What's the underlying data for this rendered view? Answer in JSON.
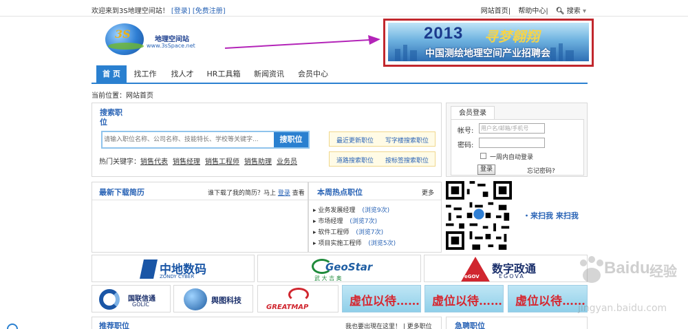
{
  "topbar": {
    "welcome": "欢迎来到3S地理空间站！",
    "login": "[登录]",
    "register": "[免费注册]",
    "home": "网站首页",
    "help": "帮助中心",
    "search": "搜索"
  },
  "logo": {
    "mark": "3S",
    "name": "地理空间站",
    "url": "www.3sSpace.net"
  },
  "banner": {
    "year": "2013",
    "slogan": "寻梦翱翔",
    "subtitle": "中国测绘地理空间产业招聘会"
  },
  "nav": {
    "items": [
      {
        "label": "首 页"
      },
      {
        "label": "找工作"
      },
      {
        "label": "找人才"
      },
      {
        "label": "HR工具箱"
      },
      {
        "label": "新闻资讯"
      },
      {
        "label": "会员中心"
      }
    ]
  },
  "breadcrumb": "当前位置：网站首页",
  "search": {
    "title": "搜索职位",
    "placeholder": "请输入职位名称、公司名称、技能特长、学校等关键字...",
    "button": "搜职位",
    "hot_label": "热门关键字：",
    "hot_keywords": [
      "销售代表",
      "销售经理",
      "销售工程师",
      "销售助理",
      "业务员"
    ],
    "quick_links": [
      "最近更新职位",
      "写字楼搜索职位",
      "道路搜索职位",
      "按标签搜索职位"
    ]
  },
  "login": {
    "tab": "会员登录",
    "account_label": "帐号:",
    "account_placeholder": "用户名/邮箱/手机号",
    "password_label": "密码:",
    "remember": "一周内自动登录",
    "button": "登录",
    "forgot": "忘记密码?"
  },
  "resumes": {
    "title": "最新下载简历",
    "prompt": "谁下载了我的简历？马上",
    "prompt_link": "登录",
    "prompt_tail": "查看"
  },
  "hot_jobs": {
    "title": "本周热点职位",
    "more": "更多",
    "items": [
      {
        "name": "业务发展经理",
        "views": "(浏览9次)"
      },
      {
        "name": "市场经理",
        "views": "(浏览7次)"
      },
      {
        "name": "软件工程师",
        "views": "(浏览7次)"
      },
      {
        "name": "项目实施工程师",
        "views": "(浏览5次)"
      }
    ]
  },
  "scan": "・来扫我  来扫我",
  "partners": {
    "zondy_cn": "中地数码",
    "zondy_en": "ZONDY CYBER",
    "geostar_en": "GeoStar",
    "geostar_cn": "武 大 吉 奥",
    "egova_mark": "eGOV",
    "egova_cn": "数字政通",
    "egova_en": "EGOVA",
    "golic_cn": "国联信通",
    "golic_en": "GOLIC",
    "yutu": "舆图科技",
    "greatmap": "GREATMAP",
    "ad_text": "虚位以待……"
  },
  "recommend": {
    "title": "推荐职位",
    "note": "我也要出現在这里！",
    "more": "更多职位",
    "urgent": "急聘职位"
  },
  "watermark": {
    "brand": "Baidu",
    "cn": "经验",
    "url": "jingyan.baidu.com"
  }
}
